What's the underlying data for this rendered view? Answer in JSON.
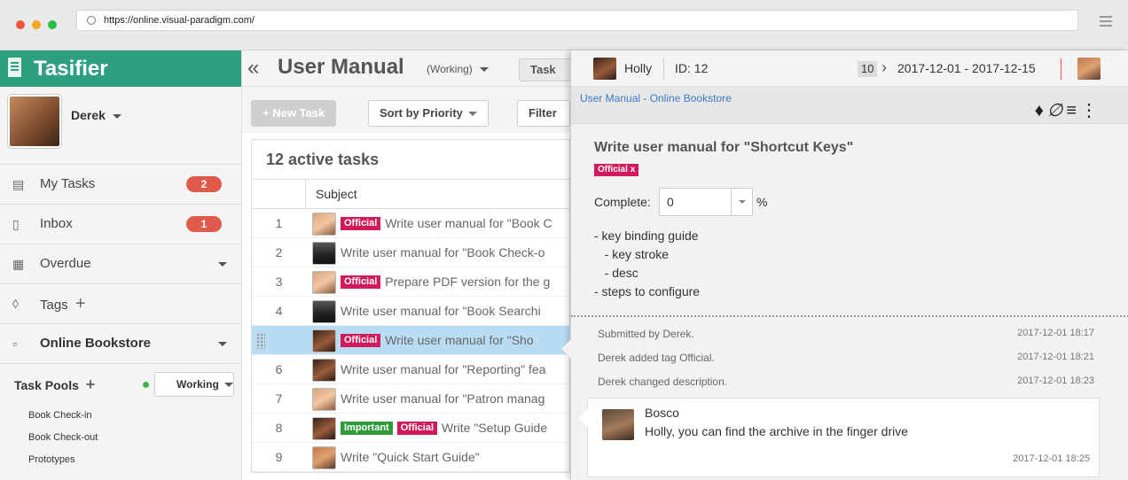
{
  "browser": {
    "url": "https://online.visual-paradigm.com/",
    "dot_colors": [
      "#f0553e",
      "#f6a623",
      "#27c046"
    ]
  },
  "sidebar": {
    "brand": "Tasifier",
    "user": "Derek",
    "items": [
      {
        "label": "My Tasks",
        "icon": "document-icon",
        "badge": "2"
      },
      {
        "label": "Inbox",
        "icon": "inbox-icon",
        "badge": "1"
      },
      {
        "label": "Overdue",
        "icon": "calendar-icon"
      },
      {
        "label": "Tags",
        "icon": "tag-icon",
        "suffix": "+"
      },
      {
        "label": "Online Bookstore",
        "icon": "folder-icon"
      }
    ],
    "task_pools_label": "Task Pools",
    "task_pools_add": "+",
    "working_label": "Working",
    "pools": [
      "Book Check-in",
      "Book Check-out",
      "Prototypes"
    ]
  },
  "main": {
    "collapse": "«",
    "title": "User Manual",
    "status": "(Working)",
    "task_btn": "Task",
    "new_task": "+ New Task",
    "sort": "Sort by Priority",
    "filter": "Filter",
    "active_count": "12 active tasks",
    "col_subject": "Subject",
    "rows": [
      {
        "n": "1",
        "tags": [
          "Official"
        ],
        "text": "Write user manual for \"Book C",
        "av": "f"
      },
      {
        "n": "2",
        "tags": [],
        "text": "Write user manual for \"Book Check-o",
        "av": "d"
      },
      {
        "n": "3",
        "tags": [
          "Official"
        ],
        "text": "Prepare PDF version for the g",
        "av": "f"
      },
      {
        "n": "4",
        "tags": [],
        "text": "Write user manual for \"Book Searchi",
        "av": "d"
      },
      {
        "n": "",
        "tags": [
          "Official"
        ],
        "text": "Write user manual for \"Sho",
        "av": "h",
        "selected": true
      },
      {
        "n": "6",
        "tags": [],
        "text": "Write user manual for \"Reporting\" fea",
        "av": "h"
      },
      {
        "n": "7",
        "tags": [],
        "text": "Write user manual for \"Patron manag",
        "av": "f"
      },
      {
        "n": "8",
        "tags": [
          "Important",
          "Official"
        ],
        "text": "Write \"Setup Guide",
        "av": "h"
      },
      {
        "n": "9",
        "tags": [],
        "text": "Write \"Quick Start Guide\"",
        "av": "m"
      }
    ]
  },
  "panel": {
    "assignee": "Holly",
    "id": "ID: 12",
    "sprint_num": "10",
    "date_range": "2017-12-01 - 2017-12-15",
    "breadcrumb": "User Manual - Online Bookstore",
    "task_title": "Write user manual for \"Shortcut Keys\"",
    "tag": "Official",
    "tag_remove": "x",
    "complete_label": "Complete:",
    "complete_value": "0",
    "percent": "%",
    "description": "- key binding guide\n   - key stroke\n   - desc\n- steps to configure",
    "log": [
      {
        "text": "Submitted by Derek.",
        "ts": "2017-12-01 18:17"
      },
      {
        "text": "Derek added tag Official.",
        "ts": "2017-12-01 18:21"
      },
      {
        "text": "Derek changed description.",
        "ts": "2017-12-01 18:23"
      }
    ],
    "comment": {
      "author": "Bosco",
      "text": "Holly, you can find the archive in the finger drive",
      "ts": "2017-12-01 18:25"
    }
  }
}
